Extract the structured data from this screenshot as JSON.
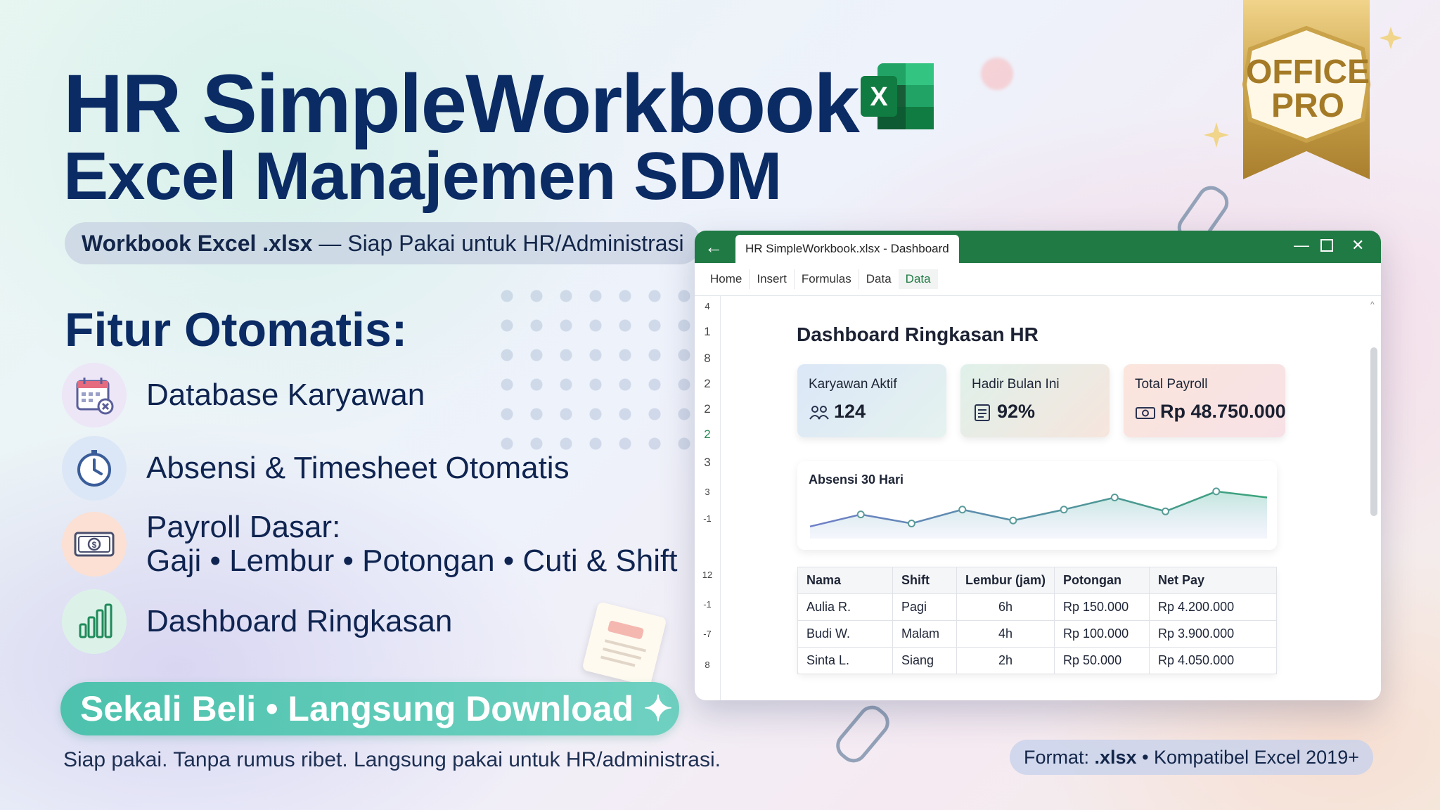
{
  "title_line1": "HR SimpleWorkbook",
  "title_line2": "Excel Manajemen SDM",
  "subtitle": {
    "bold": "Workbook Excel .xlsx",
    "rest": " — Siap Pakai untuk HR/Administrasi"
  },
  "features_title": "Fitur Otomatis:",
  "features": [
    {
      "icon": "calendar-icon",
      "text": "Database Karyawan"
    },
    {
      "icon": "clock-icon",
      "text": "Absensi & Timesheet Otomatis"
    },
    {
      "icon": "money-icon",
      "line1": "Payroll Dasar:",
      "line2": "Gaji • Lembur • Potongan • Cuti & Shift"
    },
    {
      "icon": "bar-chart-icon",
      "text": "Dashboard Ringkasan"
    }
  ],
  "cta": "Sekali Beli • Langsung Download ✦",
  "tagline": "Siap pakai. Tanpa rumus ribet. Langsung pakai untuk HR/administrasi.",
  "badge": {
    "line1": "OFFICE",
    "line2": "PRO"
  },
  "window": {
    "doc_tab": "HR SimpleWorkbook.xlsx - Dashboard",
    "ribbon_tabs": [
      "Home",
      "Insert",
      "Formulas",
      "Data",
      "Data"
    ],
    "active_tab_index": 4,
    "row_numbers": [
      "4",
      "1",
      "8",
      "2",
      "2",
      "2",
      "3",
      "3",
      "-1",
      "12",
      "-1",
      "-7",
      "8"
    ],
    "dashboard_title": "Dashboard Ringkasan HR",
    "cards": [
      {
        "label": "Karyawan Aktif",
        "value": "124",
        "icon": "people-icon"
      },
      {
        "label": "Hadir Bulan Ini",
        "value": "92%",
        "icon": "document-icon"
      },
      {
        "label": "Total Payroll",
        "value": "Rp 48.750.000",
        "icon": "cash-icon"
      }
    ],
    "chart_title": "Absensi 30 Hari",
    "table": {
      "headers": [
        "Nama",
        "Shift",
        "Lembur (jam)",
        "Potongan",
        "Net Pay"
      ],
      "rows": [
        [
          "Aulia R.",
          "Pagi",
          "6h",
          "Rp 150.000",
          "Rp 4.200.000"
        ],
        [
          "Budi W.",
          "Malam",
          "4h",
          "Rp 100.000",
          "Rp 3.900.000"
        ],
        [
          "Sinta L.",
          "Siang",
          "2h",
          "Rp 50.000",
          "Rp 4.050.000"
        ]
      ]
    }
  },
  "format": {
    "prefix": "Format: ",
    "bold": ".xlsx",
    "rest": " • Kompatibel Excel 2019+"
  },
  "chart_data": {
    "type": "line",
    "title": "Absensi 30 Hari",
    "x": [
      1,
      2,
      3,
      4,
      5,
      6,
      7,
      8,
      9,
      10
    ],
    "values": [
      20,
      40,
      25,
      48,
      30,
      48,
      68,
      45,
      78,
      68
    ],
    "ylim": [
      0,
      100
    ],
    "grid": false
  },
  "colors": {
    "excel_green": "#1f7a44",
    "navy": "#0b2b64",
    "cta_teal": "#4dc2ad",
    "gold": "#c9a24a"
  }
}
